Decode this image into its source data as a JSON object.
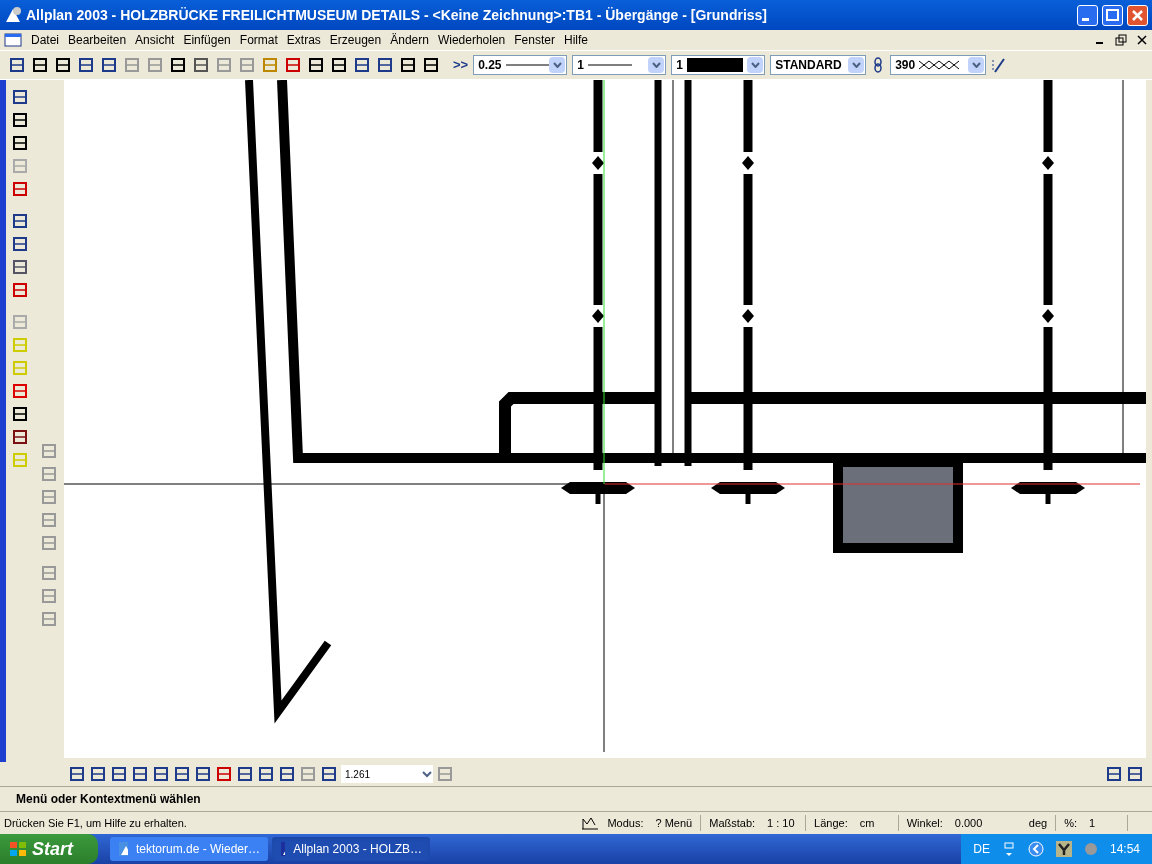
{
  "window": {
    "title": "Allplan 2003 - HOLZBRÜCKE FREILICHTMUSEUM DETAILS - <Keine Zeichnung>:TB1 - Übergänge - [Grundriss]"
  },
  "menu": [
    "Datei",
    "Bearbeiten",
    "Ansicht",
    "Einfügen",
    "Format",
    "Extras",
    "Erzeugen",
    "Ändern",
    "Wiederholen",
    "Fenster",
    "Hilfe"
  ],
  "format_bar": {
    "more": ">>",
    "pen": "0.25",
    "line": "1",
    "color_number": "1",
    "layer": "STANDARD",
    "hatch": "390"
  },
  "view_bar": {
    "zoom": "1.261"
  },
  "command_line": {
    "prompt": "Menü oder Kontextmenü wählen"
  },
  "status_bar": {
    "help": "Drücken Sie F1, um Hilfe zu erhalten.",
    "fields": [
      {
        "label": "Modus:",
        "value": "? Menü"
      },
      {
        "label": "Maßstab:",
        "value": "1 : 10"
      },
      {
        "label": "Länge:",
        "value": "cm"
      },
      {
        "label": "Winkel:",
        "value": "0.000",
        "unit": "deg"
      },
      {
        "label": "%:",
        "value": "1"
      }
    ]
  },
  "taskbar": {
    "start": "Start",
    "tasks": [
      {
        "label": "tektorum.de - Wieder…",
        "selected": false
      },
      {
        "label": "Allplan 2003 - HOLZB…",
        "selected": true
      }
    ],
    "language": "DE",
    "clock": "14:54"
  }
}
